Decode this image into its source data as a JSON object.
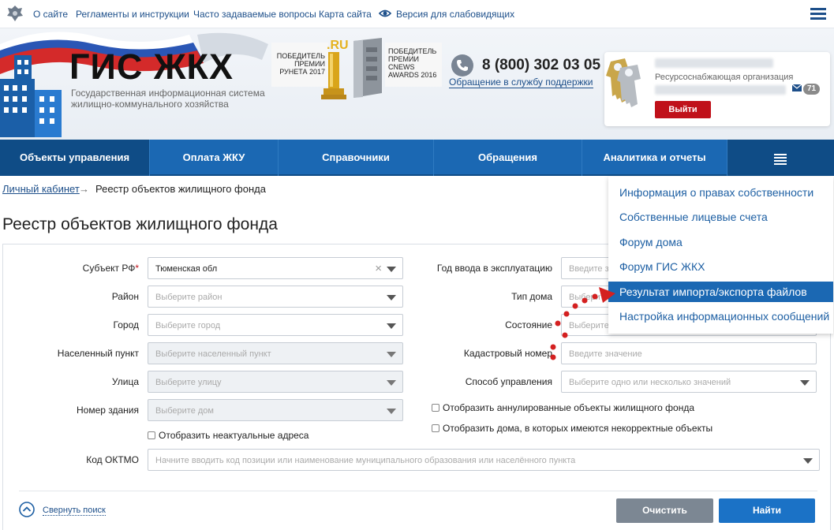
{
  "topbar": {
    "links": [
      "О сайте",
      "Регламенты и инструкции",
      "Часто задаваемые вопросы",
      "Карта сайта",
      "Версия для слабовидящих"
    ]
  },
  "header": {
    "logo_title": "ГИС ЖКХ",
    "logo_subtitle": "Государственная информационная система жилищно-коммунального хозяйства",
    "award_left": "Победитель премии Рунета 2017",
    "award_right": "Победитель премии CNews Awards 2016",
    "phone": "8 (800) 302 03 05",
    "support_link": "Обращение в службу поддержки",
    "user": {
      "org_type": "Ресурсоснабжающая организация",
      "messages_count": "71",
      "logout_label": "Выйти"
    }
  },
  "nav": {
    "items": [
      "Объекты управления",
      "Оплата ЖКУ",
      "Справочники",
      "Обращения",
      "Аналитика и отчеты"
    ]
  },
  "breadcrumb": {
    "home": "Личный кабинет",
    "arrow": "→",
    "current": "Реестр объектов жилищного фонда"
  },
  "page_title": "Реестр объектов жилищного фонда",
  "form": {
    "left": [
      {
        "label": "Субъект РФ",
        "required": "*",
        "value": "Тюменская обл"
      },
      {
        "label": "Район",
        "placeholder": "Выберите район"
      },
      {
        "label": "Город",
        "placeholder": "Выберите город"
      },
      {
        "label": "Населенный пункт",
        "placeholder": "Выберите населенный пункт"
      },
      {
        "label": "Улица",
        "placeholder": "Выберите улицу"
      },
      {
        "label": "Номер здания",
        "placeholder": "Выберите дом"
      }
    ],
    "right": [
      {
        "label": "Год ввода в эксплуатацию",
        "placeholder": "Введите з"
      },
      {
        "label": "Тип дома",
        "placeholder": "Выберите"
      },
      {
        "label": "Состояние",
        "placeholder": "Выберите"
      },
      {
        "label": "Кадастровый номер",
        "placeholder": "Введите значение"
      },
      {
        "label": "Способ управления",
        "placeholder": "Выберите одно или несколько значений"
      }
    ],
    "checkbox_outdated_addresses": "Отобразить неактуальные адреса",
    "checkbox_annulled": "Отобразить аннулированные объекты жилищного фонда",
    "checkbox_incorrect": "Отобразить дома, в которых имеются некорректные объекты",
    "oktmo_label": "Код ОКТМО",
    "oktmo_placeholder": "Начните вводить код позиции или наименование муниципального образования или населённого пункта",
    "collapse_link": "Свернуть поиск",
    "clear_button": "Очистить",
    "find_button": "Найти"
  },
  "dropdown": {
    "items": [
      "Информация о правах собственности",
      "Собственные лицевые счета",
      "Форум дома",
      "Форум ГИС ЖКХ",
      "Результат импорта/экспорта файлов",
      "Настройка информационных сообщений"
    ],
    "active_index": 4
  },
  "colors": {
    "nav_bg": "#1b68b3",
    "nav_active": "#0f4c86",
    "link": "#1d4f8a",
    "logout": "#c0111a",
    "find_button": "#1b72c6",
    "clear_button": "#7c8793",
    "annotation_dots": "#d42020"
  },
  "icons": [
    "emblem-icon",
    "eye-icon",
    "menu-icon",
    "building-logo-icon",
    "phone-icon",
    "keys-icon",
    "mail-icon",
    "collapse-up-icon",
    "chevron-down-icon",
    "clear-icon"
  ]
}
